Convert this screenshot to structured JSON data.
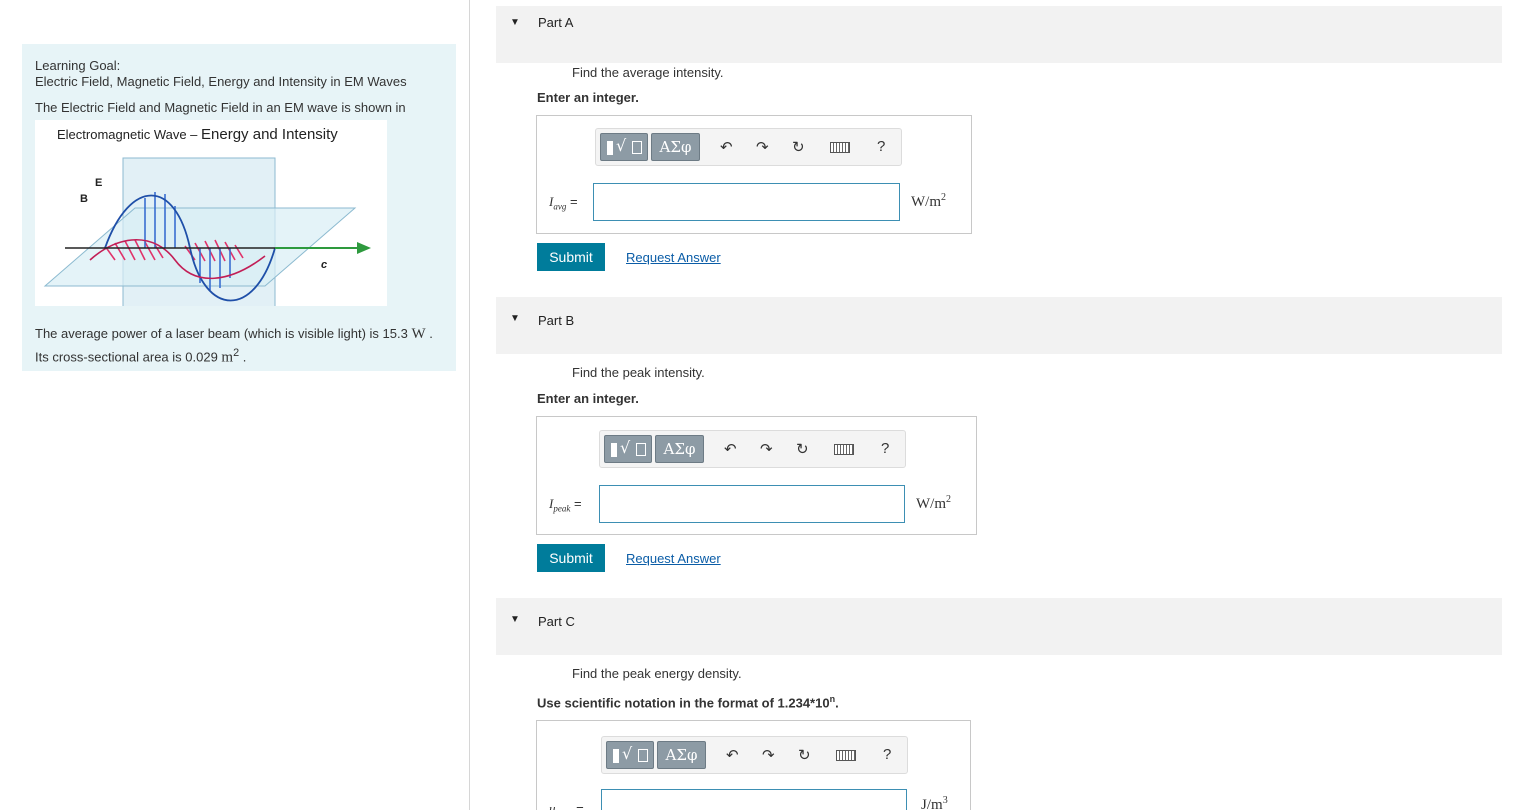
{
  "goal": {
    "title": "Learning Goal:",
    "subtitle": "Electric Field, Magnetic Field, Energy and Intensity in EM Waves",
    "text1": "The Electric Field and Magnetic Field in an EM wave is shown in",
    "figure_title_small": "Electromagnetic Wave – ",
    "figure_title_big": "Energy and Intensity",
    "figure_labels": {
      "e": "E",
      "b": "B",
      "c": "c"
    },
    "para_line1_pre": "The average power of a laser beam (which is visible light) is 15.3 ",
    "para_line1_unit": "W",
    "para_line1_post": " .",
    "para_line2_pre": "Its cross-sectional area is 0.029 ",
    "para_line2_unit": "m",
    "para_line2_sup": "2",
    "para_line2_post": " ."
  },
  "toolbar": {
    "greek_label": "ΑΣφ",
    "radical_glyph": "√",
    "undo_icon": "↶",
    "redo_icon": "↷",
    "reset_icon": "↻",
    "help_label": "?"
  },
  "parts": [
    {
      "label": "Part A",
      "question": "Find the average intensity.",
      "instruction": "Enter an integer.",
      "var_main": "I",
      "var_sub": "avg",
      "eq": " =",
      "input_value": "",
      "unit_main": "W/m",
      "unit_sup": "2",
      "submit": "Submit",
      "request": "Request Answer"
    },
    {
      "label": "Part B",
      "question": "Find the peak intensity.",
      "instruction": "Enter an integer.",
      "var_main": "I",
      "var_sub": "peak",
      "eq": " =",
      "input_value": "",
      "unit_main": "W/m",
      "unit_sup": "2",
      "submit": "Submit",
      "request": "Request Answer"
    },
    {
      "label": "Part C",
      "question": "Find the peak energy density.",
      "instruction_pre": "Use scientific notation in the format of 1.234*10",
      "instruction_sup": "n",
      "instruction_post": ".",
      "var_main": "u",
      "var_sub": "peak",
      "eq": " =",
      "input_value": "",
      "unit_main": "J/m",
      "unit_sup": "3"
    }
  ]
}
